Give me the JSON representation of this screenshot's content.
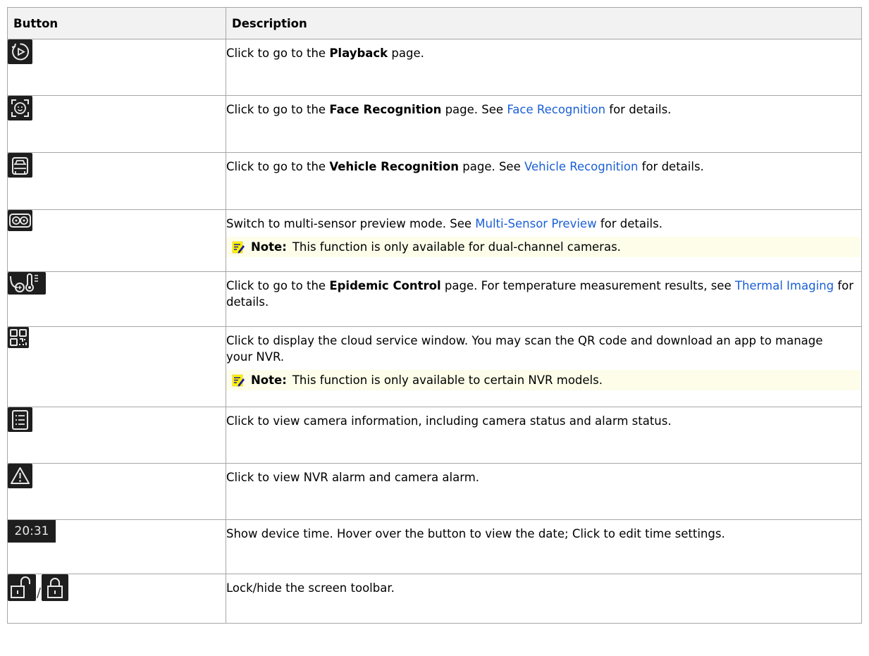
{
  "table": {
    "header": {
      "button": "Button",
      "description": "Description"
    },
    "rows": [
      {
        "icon": "playback-icon",
        "parts": [
          "Click to go to the ",
          "Playback",
          " page."
        ]
      },
      {
        "icon": "face-recognition-icon",
        "parts": [
          "Click to go to the ",
          "Face Recognition",
          " page. See ",
          "Face Recognition",
          " for details."
        ]
      },
      {
        "icon": "vehicle-recognition-icon",
        "parts": [
          "Click to go to the ",
          "Vehicle Recognition",
          " page. See ",
          "Vehicle Recognition",
          " for details."
        ]
      },
      {
        "icon": "multi-sensor-icon",
        "parts": [
          "Switch to multi-sensor preview mode. See ",
          "Multi-Sensor Preview",
          " for details."
        ],
        "note_label": "Note:",
        "note_text": "This function is only available for dual-channel cameras."
      },
      {
        "icon": "thermometer-icon",
        "parts": [
          "Click to go to the ",
          "Epidemic Control",
          " page. For temperature measurement results, see ",
          "Thermal Imaging",
          " for details."
        ]
      },
      {
        "icon": "qr-code-icon",
        "parts": [
          "Click to display the cloud service window. You may scan the QR code and download an app to manage your NVR."
        ],
        "note_label": "Note:",
        "note_text": "This function is only available to certain NVR models."
      },
      {
        "icon": "list-icon",
        "parts": [
          "Click to view camera information, including camera status and alarm status."
        ]
      },
      {
        "icon": "alarm-warning-icon",
        "parts": [
          "Click to view NVR alarm and camera alarm."
        ]
      },
      {
        "icon": "time-display",
        "time_value": "20:31",
        "parts": [
          "Show device time. Hover over the button to view the date; Click to edit time settings."
        ]
      },
      {
        "icon": "lock-icons",
        "separator": "/",
        "parts": [
          "Lock/hide the screen toolbar."
        ]
      }
    ]
  },
  "colors": {
    "link": "#1a5fd6",
    "note_bg": "#fdfdea",
    "header_bg": "#f2f2f2",
    "icon_bg": "#1e1e1e"
  }
}
